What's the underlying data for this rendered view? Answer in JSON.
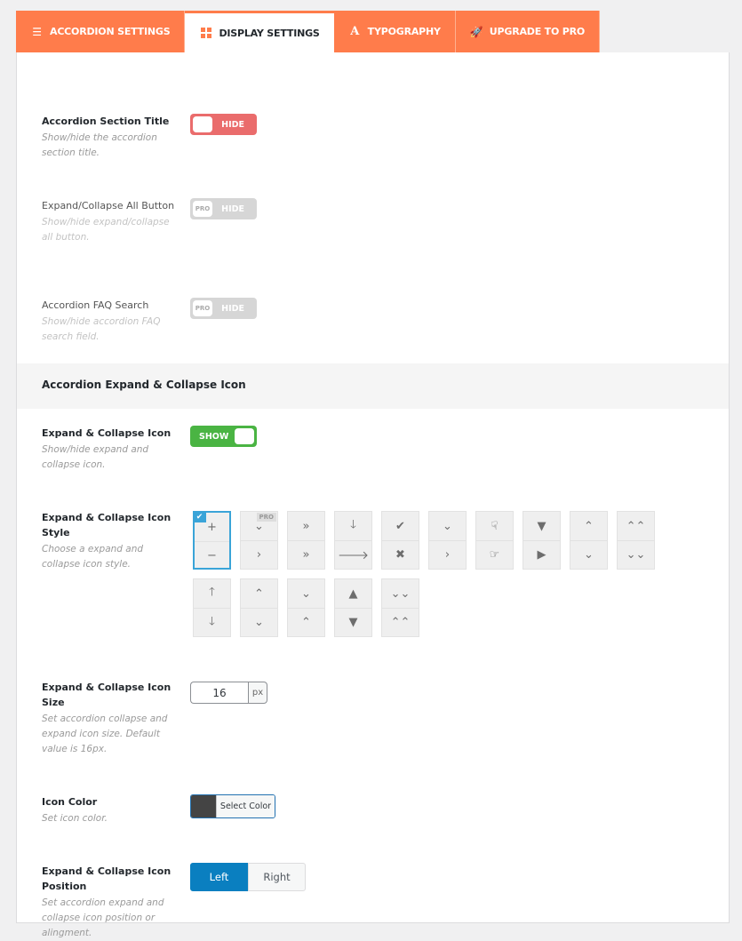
{
  "tabs": [
    {
      "label": "Accordion Settings",
      "icon": "list-icon",
      "active": false
    },
    {
      "label": "Display Settings",
      "icon": "grid-icon",
      "active": true
    },
    {
      "label": "Typography",
      "icon": "font-icon",
      "active": false
    },
    {
      "label": "Upgrade to Pro",
      "icon": "rocket-icon",
      "active": false
    }
  ],
  "settings": {
    "section_title": {
      "label": "Accordion Section Title",
      "desc": "Show/hide the accordion section title.",
      "toggle": "HIDE",
      "state": "off-red"
    },
    "expand_all": {
      "label": "Expand/Collapse All Button",
      "desc": "Show/hide expand/collapse all button.",
      "toggle": "HIDE",
      "badge": "PRO",
      "state": "disabled"
    },
    "faq_search": {
      "label": "Accordion FAQ Search",
      "desc": "Show/hide accordion FAQ search field.",
      "toggle": "HIDE",
      "badge": "PRO",
      "state": "disabled"
    }
  },
  "section_header": "Accordion Expand & Collapse Icon",
  "icon_settings": {
    "show_icon": {
      "label": "Expand & Collapse Icon",
      "desc": "Show/hide expand and collapse icon.",
      "toggle": "SHOW",
      "state": "on"
    },
    "icon_style": {
      "label": "Expand & Collapse Icon Style",
      "desc": "Choose a expand and collapse icon style.",
      "selected_index": 0,
      "pro_badge": "PRO",
      "options": [
        {
          "top": "+",
          "bottom": "−",
          "name": "plus-minus"
        },
        {
          "top": "⌄",
          "bottom": "›",
          "name": "angle-down-right",
          "pro": true
        },
        {
          "top": "»",
          "bottom": "»",
          "name": "double-angle"
        },
        {
          "top": "🡓",
          "bottom": "🡒",
          "name": "arrow-down-right"
        },
        {
          "top": "✔",
          "bottom": "✖",
          "name": "check-times"
        },
        {
          "top": "⌄",
          "bottom": "›",
          "name": "chevron-down-right"
        },
        {
          "top": "☟",
          "bottom": "☞",
          "name": "hand-down-right"
        },
        {
          "top": "▼",
          "bottom": "▶",
          "name": "caret-down-right"
        },
        {
          "top": "⌃",
          "bottom": "⌄",
          "name": "angle-up-down"
        },
        {
          "top": "⌃⌃",
          "bottom": "⌄⌄",
          "name": "double-angle-up-down"
        },
        {
          "top": "🡑",
          "bottom": "🡓",
          "name": "arrow-up-down"
        },
        {
          "top": "⌃",
          "bottom": "⌄",
          "name": "chevron-up-down"
        },
        {
          "top": "⌄",
          "bottom": "⌃",
          "name": "angle-down-up"
        },
        {
          "top": "▲",
          "bottom": "▼",
          "name": "caret-up-down"
        },
        {
          "top": "⌄⌄",
          "bottom": "⌃⌃",
          "name": "double-angle-down-up"
        }
      ]
    },
    "icon_size": {
      "label": "Expand & Collapse Icon Size",
      "desc": "Set accordion collapse and expand icon size. Default value is 16px.",
      "value": "16",
      "unit": "px"
    },
    "icon_color": {
      "label": "Icon Color",
      "desc": "Set icon color.",
      "button": "Select Color",
      "color": "#444444"
    },
    "icon_position": {
      "label": "Expand & Collapse Icon Position",
      "desc": "Set accordion expand and collapse icon position or alingment.",
      "options": [
        "Left",
        "Right"
      ],
      "selected": "Left"
    }
  }
}
